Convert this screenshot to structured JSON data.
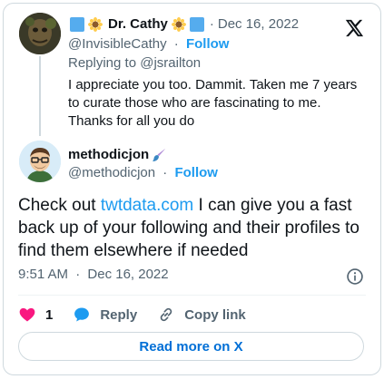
{
  "colors": {
    "accent": "#1d9bf0",
    "like": "#f91880",
    "secondary_text": "#536471",
    "border": "#cfd9de"
  },
  "reply_tweet": {
    "display_name": "Dr. Cathy",
    "handle": "@InvisibleCathy",
    "follow_label": "Follow",
    "separator": "·",
    "date": "Dec 16, 2022",
    "replying_to": "Replying to @jsrailton",
    "text": "I appreciate you too. Dammit. Taken me 7 years to curate those who are fascinating to me. Thanks for all you do"
  },
  "main_tweet": {
    "display_name": "methodicjon",
    "handle": "@methodicjon",
    "follow_label": "Follow",
    "separator": "·",
    "text_before_link": "Check out ",
    "link_text": "twtdata.com",
    "text_after_link": " I can give you a fast back up of your following and their profiles to find them elsewhere if needed",
    "time": "9:51 AM",
    "date": "Dec 16, 2022"
  },
  "actions": {
    "like_count": "1",
    "reply_label": "Reply",
    "copy_link_label": "Copy link"
  },
  "read_more_label": "Read more on X",
  "icons": [
    "x-logo-icon",
    "info-icon",
    "heart-icon",
    "reply-bubble-icon",
    "link-icon",
    "paintbrush-icon",
    "sunflower-icon"
  ]
}
